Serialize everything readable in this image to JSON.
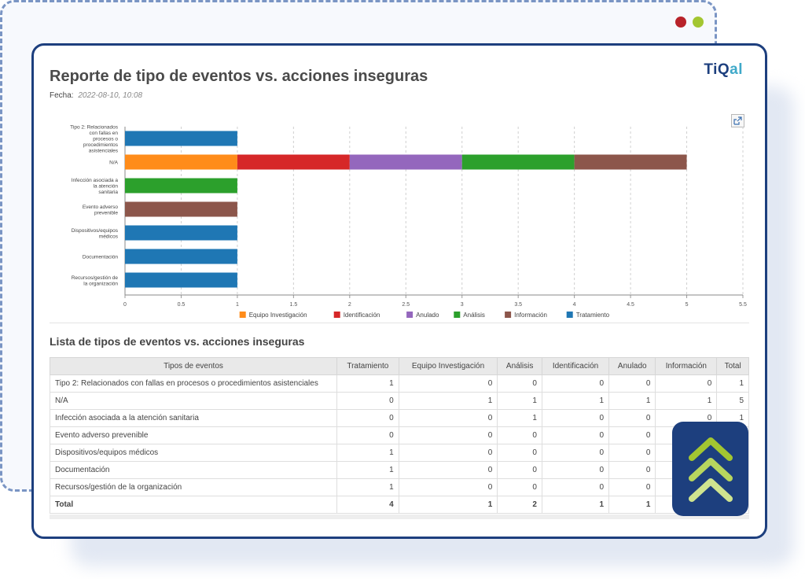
{
  "window": {
    "dot_colors": [
      "#b8232a",
      "#a3c631"
    ]
  },
  "report": {
    "title": "Reporte de tipo de eventos vs. acciones inseguras",
    "date_label": "Fecha:",
    "date_value": "2022-08-10, 10:08",
    "brand": "TiQal",
    "brand_colors": {
      "primary": "#1d3f7e",
      "accent": "#3fa9c9"
    }
  },
  "chart_data": {
    "type": "bar",
    "orientation": "horizontal",
    "stacked": true,
    "categories": [
      [
        "Tipo 2: Relacionados",
        "con fallas en",
        "procesos o",
        "procedimientos",
        "asistenciales"
      ],
      [
        "N/A"
      ],
      [
        "Infección asociada a",
        "la atención",
        "sanitaria"
      ],
      [
        "Evento adverso",
        "prevenible"
      ],
      [
        "Dispositivos/equipos",
        "médicos"
      ],
      [
        "Documentación"
      ],
      [
        "Recursos/gestión de",
        "la organización"
      ]
    ],
    "series": [
      {
        "name": "Equipo Investigación",
        "color": "#ff8c1a",
        "values": [
          0,
          1,
          0,
          0,
          0,
          0,
          0
        ]
      },
      {
        "name": "Identificación",
        "color": "#d62728",
        "values": [
          0,
          1,
          0,
          0,
          0,
          0,
          0
        ]
      },
      {
        "name": "Anulado",
        "color": "#9467bd",
        "values": [
          0,
          1,
          0,
          0,
          0,
          0,
          0
        ]
      },
      {
        "name": "Análisis",
        "color": "#2ca02c",
        "values": [
          0,
          1,
          1,
          0,
          0,
          0,
          0
        ]
      },
      {
        "name": "Información",
        "color": "#8c564b",
        "values": [
          0,
          1,
          0,
          1,
          0,
          0,
          0
        ]
      },
      {
        "name": "Tratamiento",
        "color": "#1f77b4",
        "values": [
          1,
          0,
          0,
          0,
          1,
          1,
          1
        ]
      }
    ],
    "xlim": [
      0,
      5.5
    ],
    "xticks": [
      "0",
      "0.5",
      "1",
      "1.5",
      "2",
      "2.5",
      "3",
      "3.5",
      "4",
      "4.5",
      "5",
      "5.5"
    ],
    "grid": true,
    "legend": "bottom"
  },
  "table": {
    "title": "Lista de tipos de eventos vs. acciones inseguras",
    "columns": [
      "Tipos de eventos",
      "Tratamiento",
      "Equipo Investigación",
      "Análisis",
      "Identificación",
      "Anulado",
      "Información",
      "Total"
    ],
    "rows": [
      [
        "Tipo 2: Relacionados con fallas en procesos o procedimientos asistenciales",
        "1",
        "0",
        "0",
        "0",
        "0",
        "0",
        "1"
      ],
      [
        "N/A",
        "0",
        "1",
        "1",
        "1",
        "1",
        "1",
        "5"
      ],
      [
        "Infección asociada a la atención sanitaria",
        "0",
        "0",
        "1",
        "0",
        "0",
        "0",
        "1"
      ],
      [
        "Evento adverso prevenible",
        "0",
        "0",
        "0",
        "0",
        "0",
        "",
        ""
      ],
      [
        "Dispositivos/equipos médicos",
        "1",
        "0",
        "0",
        "0",
        "0",
        "",
        ""
      ],
      [
        "Documentación",
        "1",
        "0",
        "0",
        "0",
        "0",
        "",
        ""
      ],
      [
        "Recursos/gestión de la organización",
        "1",
        "0",
        "0",
        "0",
        "0",
        "",
        ""
      ],
      [
        "Total",
        "4",
        "1",
        "2",
        "1",
        "1",
        "",
        ""
      ]
    ]
  },
  "badge": {
    "icon": "triple-chevron-up-icon",
    "bg": "#1d3f7e",
    "chevron_colors": [
      "#a3c631",
      "#b8d65e",
      "#cfe48f"
    ]
  }
}
